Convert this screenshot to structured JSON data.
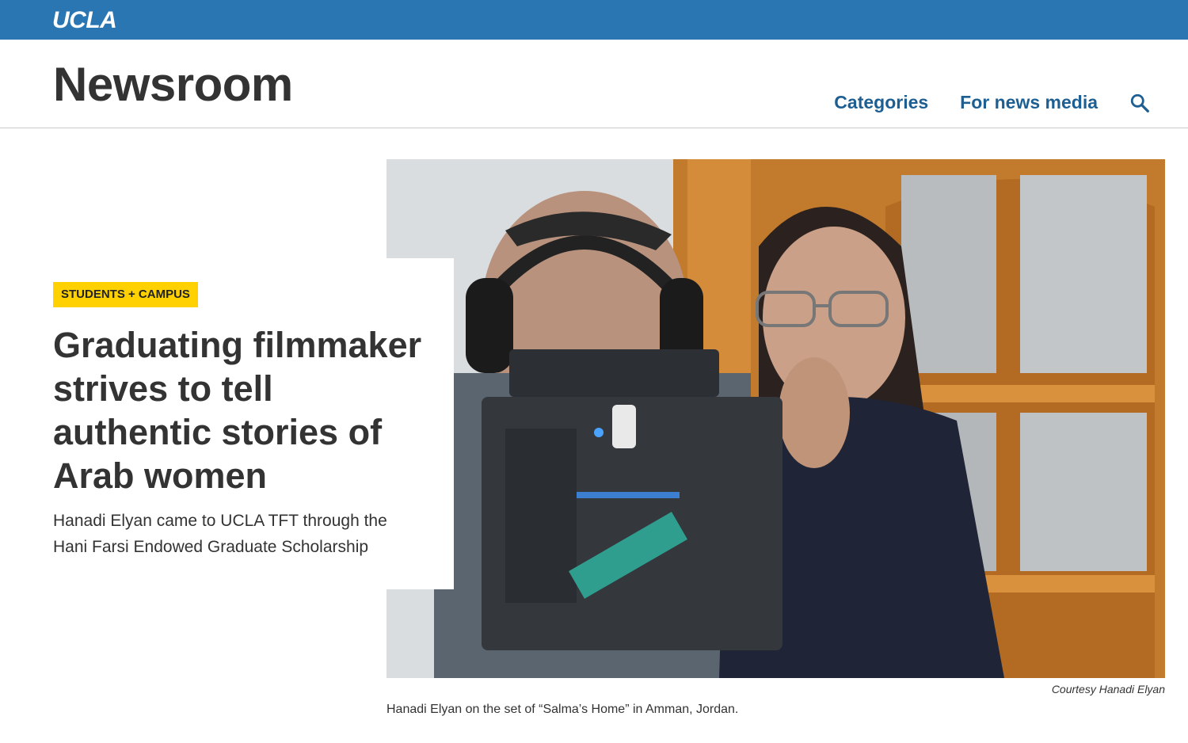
{
  "brand": {
    "logo_text": "UCLA",
    "bar_color": "#2a76b3"
  },
  "header": {
    "site_title": "Newsroom",
    "nav": [
      {
        "label": "Categories"
      },
      {
        "label": "For news media"
      }
    ],
    "search_icon": "search-icon",
    "link_color": "#1d5f92"
  },
  "feature": {
    "category": "STUDENTS + CAMPUS",
    "category_color": "#ffd100",
    "headline": "Graduating filmmaker strives to tell authentic stories of Arab women",
    "subhead": "Hanadi Elyan came to UCLA TFT through the Hani Farsi Endowed Graduate Scholarship",
    "photo_credit": "Courtesy Hanadi Elyan",
    "photo_caption": "Hanadi Elyan on the set of “Salma’s Home” in Amman, Jordan."
  }
}
